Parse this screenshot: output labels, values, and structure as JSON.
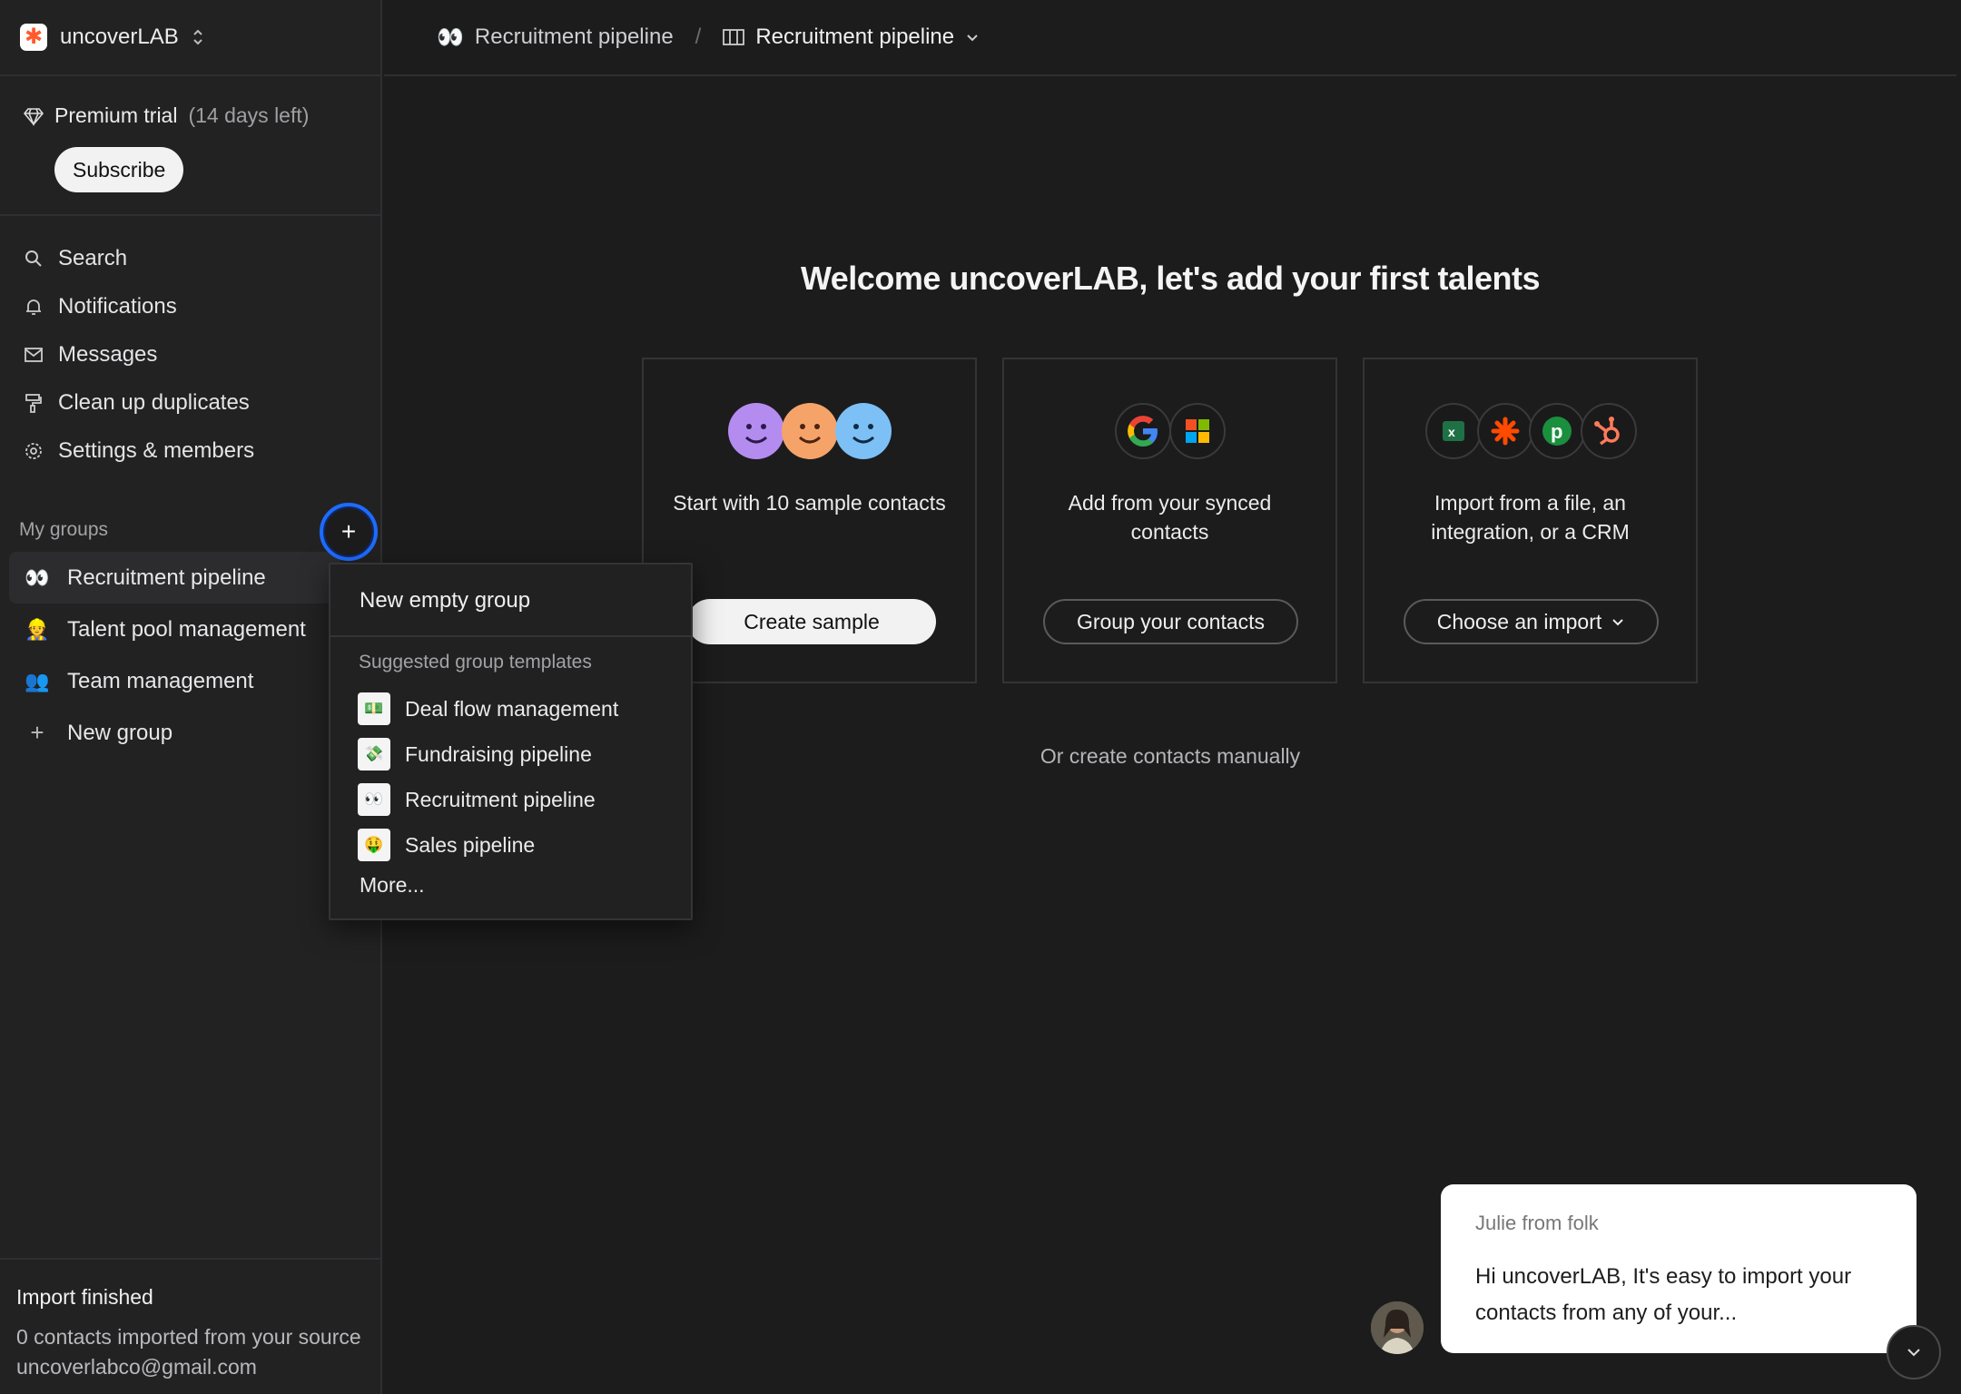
{
  "workspace": {
    "name": "uncoverLAB"
  },
  "trial": {
    "label": "Premium trial",
    "days_left": "(14 days left)",
    "subscribe_label": "Subscribe"
  },
  "nav": {
    "search": "Search",
    "notifications": "Notifications",
    "messages": "Messages",
    "clean_up": "Clean up duplicates",
    "settings": "Settings & members"
  },
  "groups": {
    "label": "My groups",
    "add_symbol": "+",
    "items": [
      {
        "emoji": "👀",
        "label": "Recruitment pipeline"
      },
      {
        "emoji": "👷",
        "label": "Talent pool management"
      },
      {
        "emoji": "👥",
        "label": "Team management"
      }
    ],
    "new_group": "New group"
  },
  "import_status": {
    "title": "Import finished",
    "text": "0 contacts imported from your source uncoverlabco@gmail.com"
  },
  "header": {
    "crumb_1": "Recruitment pipeline",
    "crumb_1_emoji": "👀",
    "separator": "/",
    "crumb_2": "Recruitment pipeline"
  },
  "main": {
    "title": "Welcome uncoverLAB, let's add your first talents",
    "cards": [
      {
        "text": "Start with 10 sample contacts",
        "button": "Create sample"
      },
      {
        "text": "Add from your synced contacts",
        "button": "Group your contacts"
      },
      {
        "text": "Import from a file, an integration, or a CRM",
        "button": "Choose an import"
      }
    ],
    "manual_link": "Or create contacts manually"
  },
  "dropdown": {
    "new_empty": "New empty group",
    "section_label": "Suggested group templates",
    "templates": [
      {
        "emoji": "💵",
        "label": "Deal flow management"
      },
      {
        "emoji": "💸",
        "label": "Fundraising pipeline"
      },
      {
        "emoji": "👀",
        "label": "Recruitment pipeline"
      },
      {
        "emoji": "🤑",
        "label": "Sales pipeline"
      }
    ],
    "more": "More..."
  },
  "chat": {
    "from": "Julie from folk",
    "message": "Hi uncoverLAB, It's easy to import your contacts from any of your..."
  },
  "colors": {
    "background": "#1c1c1d",
    "sidebar": "#222223",
    "focus_ring": "#1f6bff",
    "logo_accent": "#ff5a2c"
  }
}
